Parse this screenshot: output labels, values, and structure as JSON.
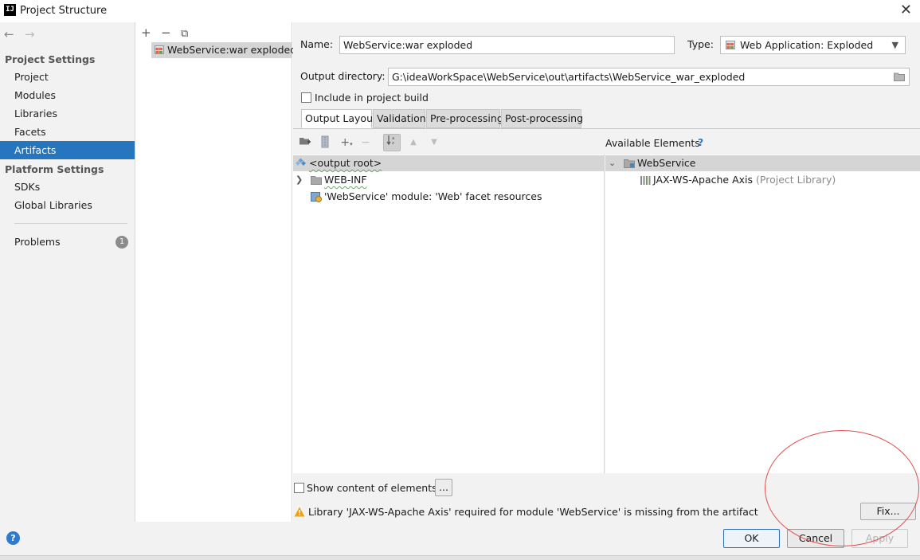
{
  "window": {
    "title": "Project Structure",
    "logo_text": "IJ"
  },
  "sidebar": {
    "back_arrow": "←",
    "forward_arrow": "→",
    "project_settings_header": "Project Settings",
    "project_items": [
      {
        "label": "Project"
      },
      {
        "label": "Modules"
      },
      {
        "label": "Libraries"
      },
      {
        "label": "Facets"
      },
      {
        "label": "Artifacts",
        "active": true
      }
    ],
    "platform_settings_header": "Platform Settings",
    "platform_items": [
      {
        "label": "SDKs"
      },
      {
        "label": "Global Libraries"
      }
    ],
    "problems_label": "Problems",
    "problems_count": "1"
  },
  "artifacts": {
    "toolbar": {
      "add": "+",
      "remove": "−",
      "copy": "⧉"
    },
    "items": [
      {
        "label": "WebService:war exploded"
      }
    ]
  },
  "editor": {
    "name_label": "Name:",
    "name_value": "WebService:war exploded",
    "type_label": "Type:",
    "type_value": "Web Application: Exploded",
    "output_dir_label": "Output directory:",
    "output_dir_value": "G:\\ideaWorkSpace\\WebService\\out\\artifacts\\WebService_war_exploded",
    "include_build_label": "Include in project build",
    "include_build_checked": false,
    "tabs": [
      {
        "label": "Output Layout",
        "active": true
      },
      {
        "label": "Validation"
      },
      {
        "label": "Pre-processing"
      },
      {
        "label": "Post-processing"
      }
    ],
    "layout_tree": {
      "root": "<output root>",
      "children": [
        {
          "label": "WEB-INF"
        },
        {
          "label": "'WebService' module: 'Web' facet resources"
        }
      ]
    },
    "available": {
      "header": "Available Elements",
      "help": "?",
      "module": "WebService",
      "library_name": "JAX-WS-Apache Axis",
      "library_suffix": "(Project Library)"
    },
    "show_content_label": "Show content of elements",
    "show_content_checked": false,
    "ellipsis_button": "...",
    "warning_text": "Library 'JAX-WS-Apache Axis' required for module 'WebService' is missing from the artifact",
    "fix_button": "Fix..."
  },
  "footer": {
    "help": "?",
    "ok": "OK",
    "cancel": "Cancel",
    "apply": "Apply"
  },
  "colors": {
    "accent": "#2675bf",
    "warning": "#f0a30a",
    "annotation": "#e05050"
  }
}
